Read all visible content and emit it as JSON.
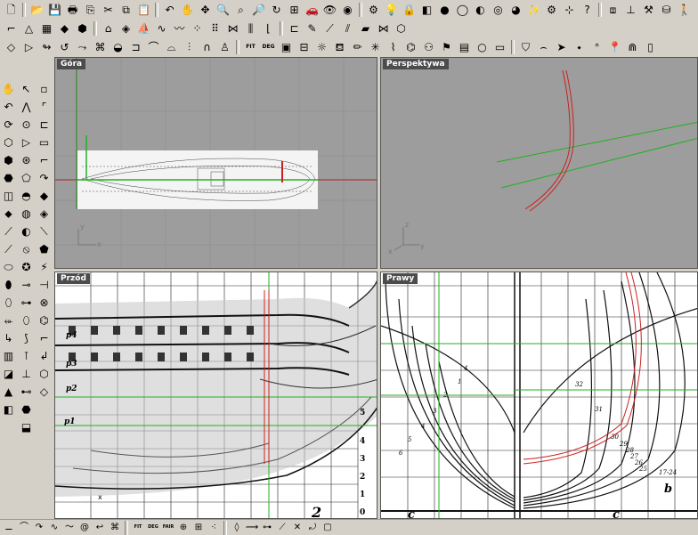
{
  "toolbars": {
    "row1": [
      {
        "name": "new-file-icon",
        "glyph": "🗋"
      },
      {
        "name": "open-folder-icon",
        "glyph": "📂"
      },
      {
        "name": "save-icon",
        "glyph": "💾"
      },
      {
        "name": "print-icon",
        "glyph": "🖶"
      },
      {
        "name": "copy-doc-icon",
        "glyph": "⎘"
      },
      {
        "name": "cut-icon",
        "glyph": "✂"
      },
      {
        "name": "copy-icon",
        "glyph": "⧉"
      },
      {
        "name": "paste-icon",
        "glyph": "📋"
      },
      {
        "name": "undo-icon",
        "glyph": "↶"
      },
      {
        "name": "pan-hand-icon",
        "glyph": "✋"
      },
      {
        "name": "move-icon",
        "glyph": "✥"
      },
      {
        "name": "zoom-window-icon",
        "glyph": "🔍"
      },
      {
        "name": "zoom-extents-icon",
        "glyph": "⌕"
      },
      {
        "name": "zoom-selected-icon",
        "glyph": "🔎"
      },
      {
        "name": "rotate-view-icon",
        "glyph": "↻"
      },
      {
        "name": "four-viewports-icon",
        "glyph": "⊞"
      },
      {
        "name": "car-icon",
        "glyph": "🚗"
      },
      {
        "name": "eye-icon",
        "glyph": "👁"
      },
      {
        "name": "point-on-icon",
        "glyph": "◉"
      },
      {
        "name": "snap-icon",
        "glyph": "⚙"
      },
      {
        "name": "lightbulb-icon",
        "glyph": "💡"
      },
      {
        "name": "lock-icon",
        "glyph": "🔒"
      },
      {
        "name": "layer-icon",
        "glyph": "◧"
      },
      {
        "name": "color-circle-icon",
        "glyph": "●"
      },
      {
        "name": "render-sphere-icon",
        "glyph": "◯"
      },
      {
        "name": "shaded-sphere-icon",
        "glyph": "◐"
      },
      {
        "name": "wireframe-sphere-icon",
        "glyph": "◎"
      },
      {
        "name": "dark-sphere-icon",
        "glyph": "◕"
      },
      {
        "name": "wand-icon",
        "glyph": "✨"
      },
      {
        "name": "options-gear-icon",
        "glyph": "⚙"
      },
      {
        "name": "grid-snap-icon",
        "glyph": "⊹"
      },
      {
        "name": "help-icon",
        "glyph": "?"
      },
      {
        "name": "box-render-icon",
        "glyph": "⧈"
      },
      {
        "name": "dimension-icon",
        "glyph": "⊥"
      },
      {
        "name": "properties-icon",
        "glyph": "⚒"
      },
      {
        "name": "cylinder-icon",
        "glyph": "⛁"
      },
      {
        "name": "person-icon",
        "glyph": "🚶"
      }
    ],
    "row2": [
      {
        "name": "polyline-icon",
        "glyph": "⌐"
      },
      {
        "name": "triangle-icon",
        "glyph": "△"
      },
      {
        "name": "grid-icon",
        "glyph": "▦"
      },
      {
        "name": "cube-icon",
        "glyph": "◆"
      },
      {
        "name": "mesh-icon",
        "glyph": "⬢"
      },
      {
        "name": "house-icon",
        "glyph": "⌂"
      },
      {
        "name": "diamond-icon",
        "glyph": "◈"
      },
      {
        "name": "ship-icon",
        "glyph": "⛵"
      },
      {
        "name": "curve-icon",
        "glyph": "∿"
      },
      {
        "name": "wave-icon",
        "glyph": "〰"
      },
      {
        "name": "points-icon",
        "glyph": "⁘"
      },
      {
        "name": "dots-grid-icon",
        "glyph": "⠿"
      },
      {
        "name": "lattice-icon",
        "glyph": "⋈"
      },
      {
        "name": "pipe-icon",
        "glyph": "⫼"
      },
      {
        "name": "stairs-icon",
        "glyph": "⌊"
      },
      {
        "name": "bracket-icon",
        "glyph": "⊏"
      },
      {
        "name": "pen-icon",
        "glyph": "✎"
      },
      {
        "name": "knife-icon",
        "glyph": "⟋"
      },
      {
        "name": "trim-icon",
        "glyph": "⫽"
      },
      {
        "name": "surface-icon",
        "glyph": "▰"
      },
      {
        "name": "join-icon",
        "glyph": "⋈"
      },
      {
        "name": "cube-outline-icon",
        "glyph": "⬡"
      }
    ],
    "row3": [
      {
        "name": "loft-icon",
        "glyph": "◇"
      },
      {
        "name": "extrude-icon",
        "glyph": "▷"
      },
      {
        "name": "sweep-icon",
        "glyph": "↬"
      },
      {
        "name": "revolve-icon",
        "glyph": "↺"
      },
      {
        "name": "blend-icon",
        "glyph": "⤳"
      },
      {
        "name": "network-icon",
        "glyph": "⌘"
      },
      {
        "name": "patch-icon",
        "glyph": "◒"
      },
      {
        "name": "offset-icon",
        "glyph": "⊐"
      },
      {
        "name": "fillet-icon",
        "glyph": "⌒"
      },
      {
        "name": "chamfer-icon",
        "glyph": "⌓"
      },
      {
        "name": "rail-icon",
        "glyph": "⫶"
      },
      {
        "name": "arch-icon",
        "glyph": "∩"
      },
      {
        "name": "person-tool-icon",
        "glyph": "♙"
      },
      {
        "name": "fit-label",
        "glyph": "FIT",
        "txt": true
      },
      {
        "name": "deg-label",
        "glyph": "DEG",
        "txt": true
      },
      {
        "name": "frame-icon",
        "glyph": "▣"
      },
      {
        "name": "tile-icon",
        "glyph": "⊟"
      },
      {
        "name": "sun-icon",
        "glyph": "☼"
      },
      {
        "name": "bucket-icon",
        "glyph": "⛾"
      },
      {
        "name": "pencil-icon",
        "glyph": "✏"
      },
      {
        "name": "sparkle-icon",
        "glyph": "✳"
      },
      {
        "name": "brush-icon",
        "glyph": "⌇"
      },
      {
        "name": "ribbon-icon",
        "glyph": "⌬"
      },
      {
        "name": "people-icon",
        "glyph": "⚇"
      },
      {
        "name": "flag-icon",
        "glyph": "⚑"
      },
      {
        "name": "doc-icon",
        "glyph": "▤"
      },
      {
        "name": "circle-icon",
        "glyph": "○"
      },
      {
        "name": "screen-icon",
        "glyph": "▭"
      },
      {
        "name": "shield-icon",
        "glyph": "⛉"
      },
      {
        "name": "spline-icon",
        "glyph": "⌢"
      },
      {
        "name": "arrow-icon",
        "glyph": "➤"
      },
      {
        "name": "node-icon",
        "glyph": "⬩"
      },
      {
        "name": "curve12-icon",
        "glyph": "ᐢ"
      },
      {
        "name": "pin-icon",
        "glyph": "📍"
      },
      {
        "name": "arch2-icon",
        "glyph": "⋒"
      },
      {
        "name": "column-icon",
        "glyph": "▯"
      }
    ],
    "left_col1": [
      "✋",
      "↶",
      "⟳",
      "⬡",
      "⬢",
      "⬣",
      "◫",
      "⬥",
      "⟋",
      "⟋",
      "⬭",
      "⬮",
      "⬯",
      "⬰",
      "↳",
      "▥",
      "◪",
      "▲",
      "◧"
    ],
    "left_col2": [
      "↖",
      "⋀",
      "⊙",
      "▷",
      "⊛",
      "⬠",
      "◓",
      "◍",
      "◐",
      "⦸",
      "✪",
      "⊸",
      "⊶",
      "⬯",
      "⟆",
      "⊺",
      "⊥",
      "⊷",
      "⬣",
      "⬓"
    ],
    "left_col3": [
      "▫",
      "⌜",
      "⊏",
      "▭",
      "⌐",
      "↷",
      "◆",
      "◈",
      "⟍",
      "⬟",
      "⚡",
      "⊣",
      "⊗",
      "⌬",
      "⌐",
      "↲",
      "⬡",
      "◇"
    ]
  },
  "viewports": {
    "top": {
      "title": "Góra",
      "axis_y": "y",
      "axis_x": "x"
    },
    "perspective": {
      "title": "Perspektywa",
      "axis_z": "z",
      "axis_y": "y",
      "axis_x": "x"
    },
    "front": {
      "title": "Przód",
      "deck_labels": [
        "p4",
        "p3",
        "p2",
        "p1"
      ],
      "waterlines": [
        "5",
        "4",
        "3",
        "2",
        "1",
        "0"
      ],
      "station": "2",
      "mark": "x"
    },
    "right": {
      "title": "Prawy",
      "frame_numbers": [
        "4",
        "1",
        "2",
        "3",
        "4",
        "5",
        "6",
        "32",
        "31",
        "30",
        "29",
        "28",
        "27",
        "26",
        "25",
        "17-24"
      ],
      "letters": [
        "b",
        "c",
        "c"
      ]
    }
  },
  "statusbar": [
    {
      "name": "status-icon",
      "glyph": "⚊"
    },
    {
      "name": "status-arc1",
      "glyph": "⌒"
    },
    {
      "name": "status-arc2",
      "glyph": "↷"
    },
    {
      "name": "status-curve",
      "glyph": "∿"
    },
    {
      "name": "status-wave",
      "glyph": "〜"
    },
    {
      "name": "status-spiral",
      "glyph": "@"
    },
    {
      "name": "status-hook",
      "glyph": "↩"
    },
    {
      "name": "status-clip",
      "glyph": "⌘"
    },
    {
      "name": "status-fit",
      "glyph": "FIT",
      "txt": true
    },
    {
      "name": "status-deg",
      "glyph": "DEG",
      "txt": true
    },
    {
      "name": "status-fair",
      "glyph": "FAIR",
      "txt": true
    },
    {
      "name": "status-pin",
      "glyph": "⊕"
    },
    {
      "name": "status-grid",
      "glyph": "⊞"
    },
    {
      "name": "status-points",
      "glyph": "⁖"
    },
    {
      "name": "status-diamond",
      "glyph": "◊"
    },
    {
      "name": "status-slide",
      "glyph": "⟿"
    },
    {
      "name": "status-node",
      "glyph": "⊶"
    },
    {
      "name": "status-knife",
      "glyph": "⟋"
    },
    {
      "name": "status-x",
      "glyph": "✕"
    },
    {
      "name": "status-twist",
      "glyph": "⤾"
    },
    {
      "name": "status-box",
      "glyph": "▢"
    }
  ]
}
